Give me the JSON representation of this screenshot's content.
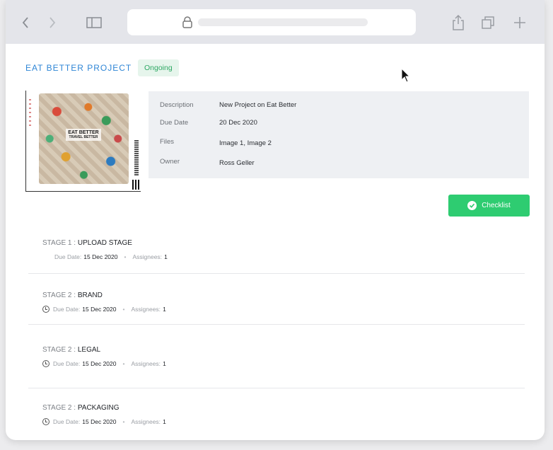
{
  "project": {
    "title": "EAT BETTER PROJECT",
    "status": "Ongoing",
    "thumbnail_logo": "EAT BETTER",
    "thumbnail_sub": "TRAVEL BETTER"
  },
  "details": {
    "description_label": "Description",
    "description_value": "New Project on Eat Better",
    "due_label": "Due Date",
    "due_value": "20 Dec 2020",
    "files_label": "Files",
    "files_value": "Image 1, Image 2",
    "owner_label": "Owner",
    "owner_value": "Ross Geller"
  },
  "checklist_label": "Checklist",
  "stages": [
    {
      "prefix": "STAGE 1 : ",
      "name": "UPLOAD STAGE",
      "due_label": "Due Date:",
      "due": "15 Dec 2020",
      "assignees_label": "Assignees:",
      "assignees": "1"
    },
    {
      "prefix": "STAGE 2 : ",
      "name": "BRAND",
      "due_label": "Due Date:",
      "due": "15 Dec 2020",
      "assignees_label": "Assignees:",
      "assignees": "1"
    },
    {
      "prefix": "STAGE 2 : ",
      "name": "LEGAL",
      "due_label": "Due Date:",
      "due": "15 Dec 2020",
      "assignees_label": "Assignees:",
      "assignees": "1"
    },
    {
      "prefix": "STAGE 2 : ",
      "name": "PACKAGING",
      "due_label": "Due Date:",
      "due": "15 Dec 2020",
      "assignees_label": "Assignees:",
      "assignees": "1"
    }
  ],
  "colors": {
    "accent_blue": "#2f86d6",
    "success_green": "#2ecc71",
    "badge_bg": "#e6f5ec"
  }
}
